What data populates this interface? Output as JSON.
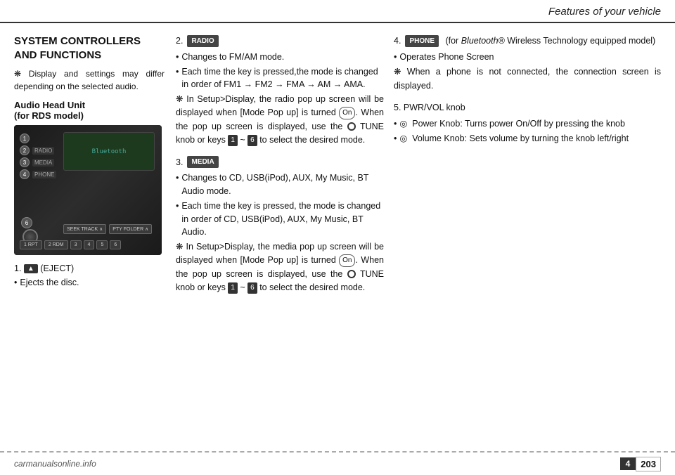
{
  "header": {
    "title": "Features of your vehicle"
  },
  "left_col": {
    "section_title": "SYSTEM CONTROLLERS\nAND FUNCTIONS",
    "asterisk_note": "❋ Display and settings may differ depending on the selected audio.",
    "sub_heading": "Audio Head Unit\n(for RDS model)",
    "eject_label": "1.",
    "eject_badge": "▲",
    "eject_text": "(EJECT)",
    "eject_bullet": "Ejects the disc."
  },
  "mid_col": {
    "item2_num": "2.",
    "item2_badge": "RADIO",
    "item2_bullets": [
      "Changes to FM/AM mode.",
      "Each time the key is pressed,the mode is changed in order of FM1 → FM2 → FMA → AM → AMA."
    ],
    "item2_note": "❋ In Setup>Display, the radio pop up screen will be displayed when [Mode Pop up] is turned On . When the pop up screen is displayed, use the ◎ TUNE knob or keys 1 ~ 6 to select the desired mode.",
    "item3_num": "3.",
    "item3_badge": "MEDIA",
    "item3_bullets": [
      "Changes to CD, USB(iPod), AUX, My Music, BT Audio mode.",
      "Each time the key is pressed, the mode is changed in order of CD, USB(iPod), AUX, My Music, BT Audio."
    ],
    "item3_note": "❋ In Setup>Display, the media pop up screen will be displayed when [Mode Pop up] is turned On . When the pop up screen is displayed, use the ◎ TUNE knob or keys 1 ~ 6 to select the desired mode."
  },
  "right_col": {
    "item4_num": "4.",
    "item4_badge": "PHONE",
    "item4_for": "(for",
    "item4_bluetooth": "Bluetooth®",
    "item4_wireless": "Wireless Technology equipped model)",
    "item4_bullets": [
      "Operates Phone Screen"
    ],
    "item4_note": "❋ When a phone is not connected, the connection screen is displayed.",
    "item5_num": "5. PWR/VOL knob",
    "item5_bullets": [
      "◎  Power Knob: Turns power On/Off by pressing the knob",
      "◎  Volume Knob: Sets volume by turning the knob left/right"
    ]
  },
  "footer": {
    "logo": "carmanualsonline.info",
    "page_section": "4",
    "page_number": "203"
  }
}
